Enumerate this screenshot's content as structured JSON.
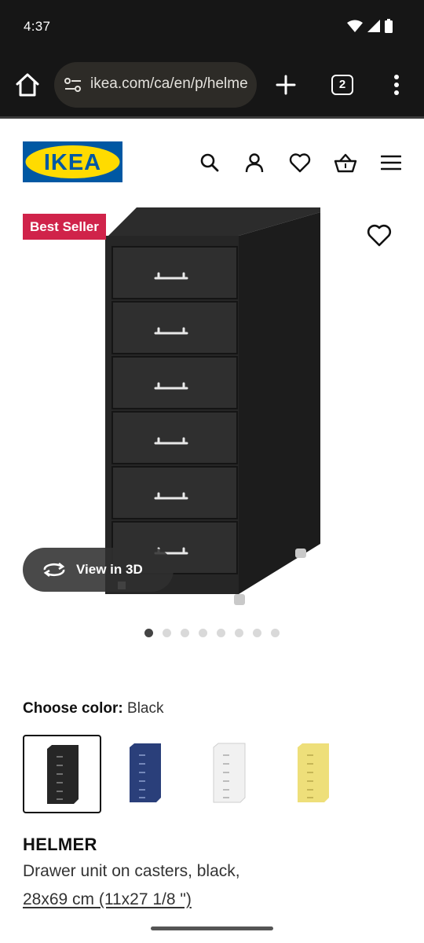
{
  "status_bar": {
    "time": "4:37"
  },
  "browser": {
    "url": "ikea.com/ca/en/p/helmer",
    "tab_count": "2"
  },
  "header": {
    "logo_text": "IKEA",
    "icons": [
      "search-icon",
      "account-icon",
      "favourites-icon",
      "cart-icon",
      "hamburger-menu-icon"
    ]
  },
  "product": {
    "badge": "Best Seller",
    "view_3d_label": "View in 3D",
    "gallery": {
      "total_images": 8,
      "active_index": 0
    },
    "choose_color_label": "Choose color:",
    "selected_color": "Black",
    "swatches": [
      {
        "name": "Black",
        "color": "#2b2b2b",
        "selected": true
      },
      {
        "name": "Blue",
        "color": "#2a3f7a",
        "selected": false
      },
      {
        "name": "White",
        "color": "#f1f1f1",
        "selected": false
      },
      {
        "name": "Yellow",
        "color": "#eedf7a",
        "selected": false
      }
    ],
    "name": "HELMER",
    "description": "Drawer unit on casters, black,",
    "size": "28x69 cm (11x27 1/8 \")"
  },
  "colors": {
    "ikea_blue": "#0058a3",
    "ikea_yellow": "#ffdb00",
    "badge_red": "#d0234a",
    "browser_bg": "#161616"
  }
}
